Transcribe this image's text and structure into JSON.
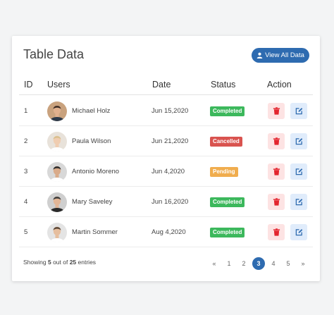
{
  "card": {
    "title": "Table Data",
    "view_all_label": "View All Data"
  },
  "table": {
    "columns": [
      "ID",
      "Users",
      "Date",
      "Status",
      "Action"
    ],
    "rows": [
      {
        "id": "1",
        "user": "Michael Holz",
        "date": "Jun 15,2020",
        "status": "Completed"
      },
      {
        "id": "2",
        "user": "Paula Wilson",
        "date": "Jun 21,2020",
        "status": "Cancelled"
      },
      {
        "id": "3",
        "user": "Antonio Moreno",
        "date": "Jun 4,2020",
        "status": "Pending"
      },
      {
        "id": "4",
        "user": "Mary Saveley",
        "date": "Jun 16,2020",
        "status": "Completed"
      },
      {
        "id": "5",
        "user": "Martin Sommer",
        "date": "Aug 4,2020",
        "status": "Completed"
      }
    ]
  },
  "footer": {
    "showing_prefix": "Showing ",
    "shown_count": "5",
    "showing_middle": " out of ",
    "total_count": "25",
    "showing_suffix": " entries"
  },
  "pagination": {
    "first": "«",
    "pages": [
      "1",
      "2",
      "3",
      "4",
      "5"
    ],
    "current_page": "3",
    "last": "»"
  },
  "colors": {
    "accent": "#2e6bb0",
    "completed": "#3cb85c",
    "cancelled": "#d9534f",
    "pending": "#f0ad4e",
    "delete_icon": "#e3262f",
    "edit_icon": "#2e6bb0"
  },
  "icons": {
    "view_all": "user-icon",
    "delete": "trash-icon",
    "edit": "edit-icon"
  }
}
